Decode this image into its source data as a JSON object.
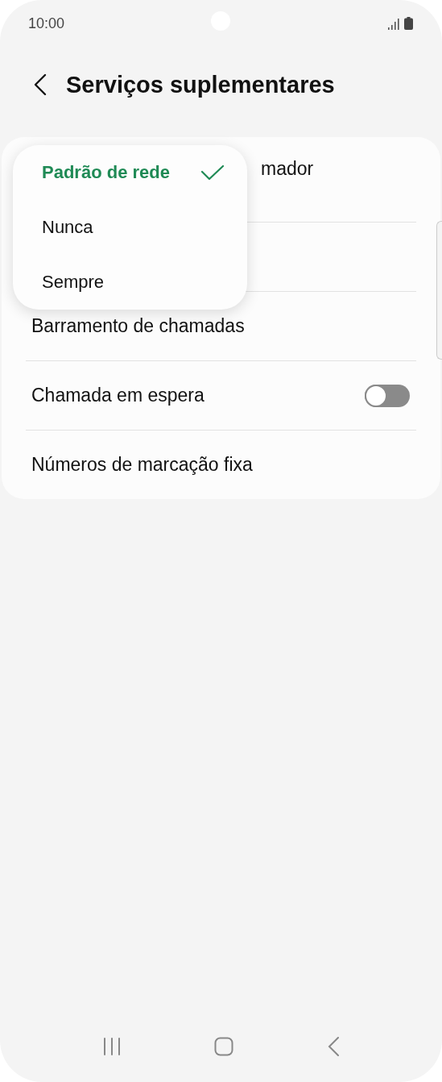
{
  "status_bar": {
    "time": "10:00"
  },
  "header": {
    "title": "Serviços suplementares"
  },
  "rows": [
    {
      "kind": "covered",
      "label": "mador"
    },
    {
      "kind": "hidden"
    },
    {
      "kind": "plain",
      "label": "Barramento de chamadas"
    },
    {
      "kind": "toggle",
      "label": "Chamada em espera",
      "on": false
    },
    {
      "kind": "plain",
      "label": "Números de marcação fixa"
    }
  ],
  "menu": {
    "options": [
      {
        "label": "Padrão de rede",
        "selected": true
      },
      {
        "label": "Nunca",
        "selected": false
      },
      {
        "label": "Sempre",
        "selected": false
      }
    ]
  }
}
